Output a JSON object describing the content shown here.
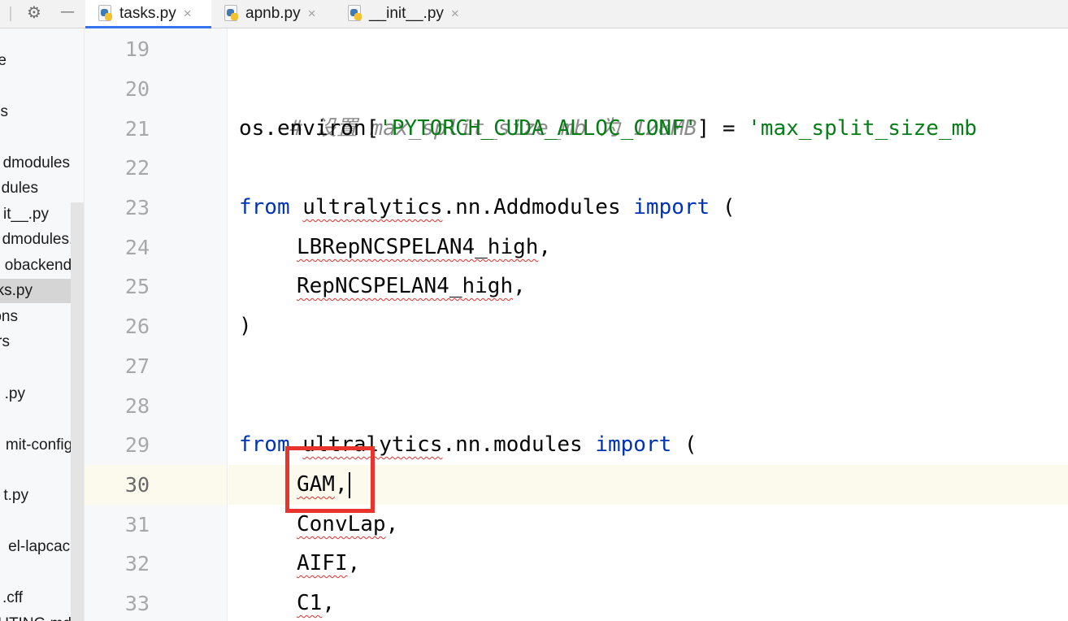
{
  "toolbar": {
    "settings_icon": "gear-icon",
    "minimize_icon": "minimize-icon",
    "settings_glyph": "⚙",
    "minimize_glyph": "—"
  },
  "tabs": [
    {
      "label": "tasks.py",
      "active": true,
      "icon": "python-file-icon"
    },
    {
      "label": "apnb.py",
      "active": false,
      "icon": "python-file-icon"
    },
    {
      "label": "__init__.py",
      "active": false,
      "icon": "python-file-icon"
    }
  ],
  "tab_close_glyph": "×",
  "tree_items": [
    {
      "label": "e"
    },
    {
      "label": "s"
    },
    {
      "label": "dmodules"
    },
    {
      "label": "dules"
    },
    {
      "label": "it__.py"
    },
    {
      "label": "dmodules.zi"
    },
    {
      "label": "obackend.p"
    },
    {
      "label": "ks.py",
      "selected": true
    },
    {
      "label": "ons"
    },
    {
      "label": "rs"
    },
    {
      "label": ".py"
    },
    {
      "label": "mit-config.y"
    },
    {
      "label": "t.py"
    },
    {
      "label": "el-lapcace."
    },
    {
      "label": ".cff"
    },
    {
      "label": "UTING.md"
    }
  ],
  "editor": {
    "line_numbers": [
      "19",
      "20",
      "21",
      "22",
      "23",
      "24",
      "25",
      "26",
      "27",
      "28",
      "29",
      "30",
      "31",
      "32",
      "33"
    ],
    "current_line": "30",
    "code": {
      "l20_comment": "# 设置 max_split_size_mb 为 128MB",
      "l21_a": "os.environ[",
      "l21_str1": "'PYTORCH_CUDA_ALLOC_CONF'",
      "l21_b": "] = ",
      "l21_str2": "'max_split_size_mb",
      "l23_from": "from",
      "l23_mod": "ultralytics",
      "l23_rest": ".nn.Addmodules ",
      "l23_import": "import",
      "l23_paren": " (",
      "l24_name": "LBRepNCSPELAN4_high",
      "l24_comma": ",",
      "l25_name": "RepNCSPELAN4_high",
      "l25_comma": ",",
      "l26_paren": ")",
      "l29_from": "from",
      "l29_mod": "ultralytics",
      "l29_rest": ".nn.modules ",
      "l29_import": "import",
      "l29_paren": " (",
      "l30_name": "GAM",
      "l30_comma": ",",
      "l31_name": "ConvLap",
      "l31_comma": ",",
      "l32_name": "AIFI",
      "l32_comma": ",",
      "l33_name": "C1",
      "l33_comma": ","
    }
  },
  "annotation": {
    "color": "#e8342c"
  }
}
